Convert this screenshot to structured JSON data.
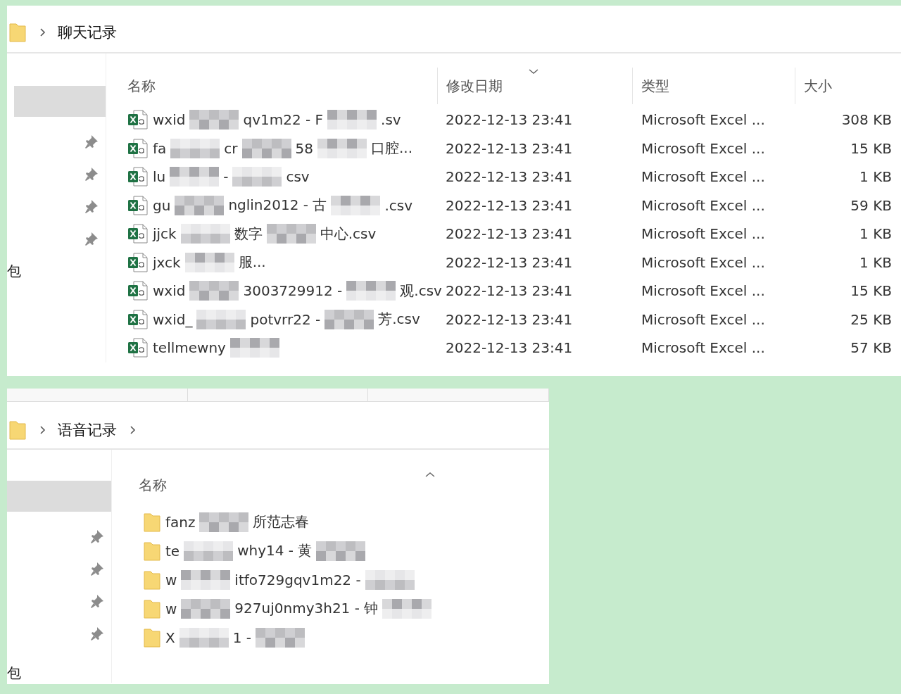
{
  "windows": [
    {
      "kind": "details",
      "ribbon_strip": false,
      "breadcrumb": [
        {
          "label": "聊天记录"
        }
      ],
      "trailing_chevron": false,
      "nav_items": [
        {
          "kind": "blank-selected"
        },
        {
          "kind": "pin"
        },
        {
          "kind": "pin"
        },
        {
          "kind": "pin"
        },
        {
          "kind": "pin"
        },
        {
          "kind": "text",
          "label": "包"
        }
      ],
      "columns": [
        {
          "label": "名称",
          "kind": "plain"
        },
        {
          "label": "修改日期",
          "kind": "sort-desc"
        },
        {
          "label": "类型",
          "kind": "plain"
        },
        {
          "label": "大小",
          "kind": "plain"
        }
      ],
      "rows": [
        {
          "kind": "spreadsheet",
          "name_parts": [
            {
              "kind": "text",
              "text": "wxid"
            },
            {
              "kind": "blur"
            },
            {
              "kind": "text",
              "text": "qv1m22 - F"
            },
            {
              "kind": "blur"
            },
            {
              "kind": "text",
              "text": ".sv"
            }
          ],
          "modified": "2022-12-13 23:41",
          "type": "Microsoft Excel ...",
          "size": "308 KB"
        },
        {
          "kind": "spreadsheet",
          "name_parts": [
            {
              "kind": "text",
              "text": "fa"
            },
            {
              "kind": "blur"
            },
            {
              "kind": "text",
              "text": "cr"
            },
            {
              "kind": "blur"
            },
            {
              "kind": "text",
              "text": "58"
            },
            {
              "kind": "blur"
            },
            {
              "kind": "text",
              "text": "口腔..."
            }
          ],
          "modified": "2022-12-13 23:41",
          "type": "Microsoft Excel ...",
          "size": "15 KB"
        },
        {
          "kind": "spreadsheet",
          "name_parts": [
            {
              "kind": "text",
              "text": "lu"
            },
            {
              "kind": "blur"
            },
            {
              "kind": "text",
              "text": "-"
            },
            {
              "kind": "blur"
            },
            {
              "kind": "text",
              "text": "csv"
            }
          ],
          "modified": "2022-12-13 23:41",
          "type": "Microsoft Excel ...",
          "size": "1 KB"
        },
        {
          "kind": "spreadsheet",
          "name_parts": [
            {
              "kind": "text",
              "text": "gu"
            },
            {
              "kind": "blur"
            },
            {
              "kind": "text",
              "text": "nglin2012 - 古"
            },
            {
              "kind": "blur"
            },
            {
              "kind": "text",
              "text": ".csv"
            }
          ],
          "modified": "2022-12-13 23:41",
          "type": "Microsoft Excel ...",
          "size": "59 KB"
        },
        {
          "kind": "spreadsheet",
          "name_parts": [
            {
              "kind": "text",
              "text": "jjck"
            },
            {
              "kind": "blur"
            },
            {
              "kind": "text",
              "text": "数字"
            },
            {
              "kind": "blur"
            },
            {
              "kind": "text",
              "text": "中心.csv"
            }
          ],
          "modified": "2022-12-13 23:41",
          "type": "Microsoft Excel ...",
          "size": "1 KB"
        },
        {
          "kind": "spreadsheet",
          "name_parts": [
            {
              "kind": "text",
              "text": "jxck"
            },
            {
              "kind": "blur"
            },
            {
              "kind": "text",
              "text": "服..."
            }
          ],
          "modified": "2022-12-13 23:41",
          "type": "Microsoft Excel ...",
          "size": "1 KB"
        },
        {
          "kind": "spreadsheet",
          "name_parts": [
            {
              "kind": "text",
              "text": "wxid"
            },
            {
              "kind": "blur"
            },
            {
              "kind": "text",
              "text": "3003729912 -"
            },
            {
              "kind": "blur"
            },
            {
              "kind": "text",
              "text": "观.csv"
            }
          ],
          "modified": "2022-12-13 23:41",
          "type": "Microsoft Excel ...",
          "size": "15 KB"
        },
        {
          "kind": "spreadsheet",
          "name_parts": [
            {
              "kind": "text",
              "text": "wxid_"
            },
            {
              "kind": "blur"
            },
            {
              "kind": "text",
              "text": "potvrr22 -"
            },
            {
              "kind": "blur"
            },
            {
              "kind": "text",
              "text": "芳.csv"
            }
          ],
          "modified": "2022-12-13 23:41",
          "type": "Microsoft Excel ...",
          "size": "25 KB"
        },
        {
          "kind": "spreadsheet",
          "name_parts": [
            {
              "kind": "text",
              "text": "tellmewny"
            },
            {
              "kind": "blur"
            }
          ],
          "modified": "2022-12-13 23:41",
          "type": "Microsoft Excel ...",
          "size": "57 KB"
        }
      ]
    },
    {
      "kind": "names",
      "ribbon_strip": true,
      "breadcrumb": [
        {
          "label": "语音记录"
        }
      ],
      "trailing_chevron": true,
      "nav_items": [
        {
          "kind": "blank-selected"
        },
        {
          "kind": "pin"
        },
        {
          "kind": "pin"
        },
        {
          "kind": "pin"
        },
        {
          "kind": "pin"
        },
        {
          "kind": "text",
          "label": "包"
        }
      ],
      "columns": [
        {
          "label": "名称",
          "kind": "sort-asc"
        }
      ],
      "rows": [
        {
          "kind": "folder",
          "name_parts": [
            {
              "kind": "text",
              "text": "fanz"
            },
            {
              "kind": "blur"
            },
            {
              "kind": "text",
              "text": "所范志春"
            }
          ]
        },
        {
          "kind": "folder",
          "name_parts": [
            {
              "kind": "text",
              "text": "te"
            },
            {
              "kind": "blur"
            },
            {
              "kind": "text",
              "text": "why14 - 黄"
            },
            {
              "kind": "blur"
            }
          ]
        },
        {
          "kind": "folder",
          "name_parts": [
            {
              "kind": "text",
              "text": "w"
            },
            {
              "kind": "blur"
            },
            {
              "kind": "text",
              "text": "itfo729gqv1m22 -"
            },
            {
              "kind": "blur"
            }
          ]
        },
        {
          "kind": "folder",
          "name_parts": [
            {
              "kind": "text",
              "text": "w"
            },
            {
              "kind": "blur"
            },
            {
              "kind": "text",
              "text": "927uj0nmy3h21 - 钟"
            },
            {
              "kind": "blur"
            }
          ]
        },
        {
          "kind": "folder",
          "name_parts": [
            {
              "kind": "text",
              "text": "X"
            },
            {
              "kind": "blur"
            },
            {
              "kind": "text",
              "text": "1 -"
            },
            {
              "kind": "blur"
            }
          ]
        }
      ]
    }
  ]
}
